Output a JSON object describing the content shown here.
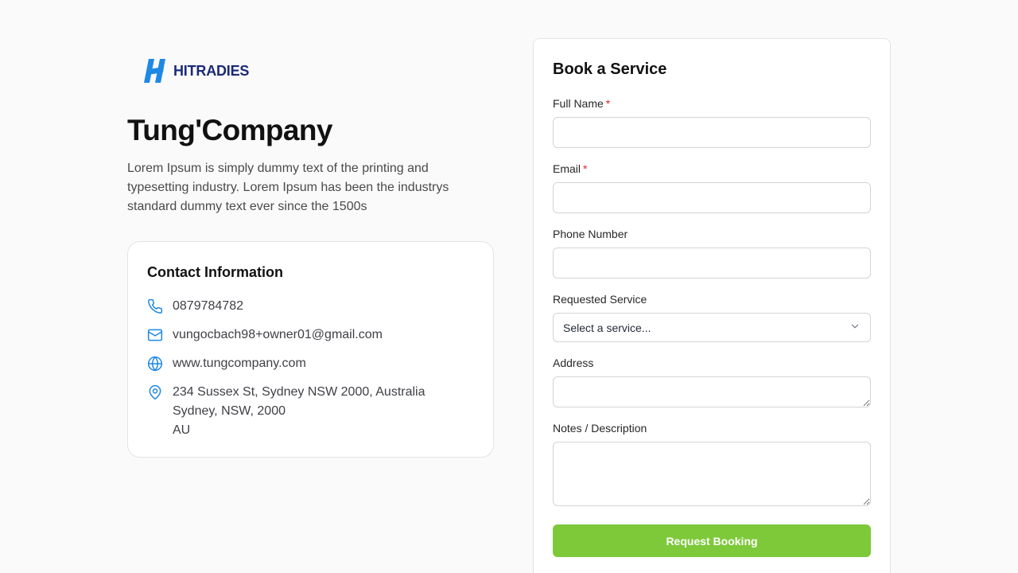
{
  "brand": {
    "logo_text": "HITRADIES",
    "logo_color": "#1b2a78",
    "logo_mark_color": "#1e88e5"
  },
  "company": {
    "name": "Tung'Company",
    "description": "Lorem Ipsum is simply dummy text of the printing and typesetting industry. Lorem Ipsum has been the industrys standard dummy text ever since the 1500s"
  },
  "contact": {
    "title": "Contact Information",
    "icon_color": "#1e88e5",
    "phone": {
      "icon": "phone-icon",
      "value": "0879784782"
    },
    "email": {
      "icon": "mail-icon",
      "value": "vungocbach98+owner01@gmail.com"
    },
    "website": {
      "icon": "globe-icon",
      "value": "www.tungcompany.com"
    },
    "address": {
      "icon": "map-pin-icon",
      "line1": "234 Sussex St, Sydney NSW 2000, Australia",
      "line2": "Sydney, NSW, 2000",
      "line3": "AU"
    }
  },
  "form": {
    "title": "Book a Service",
    "required_marker": "*",
    "full_name": {
      "label": "Full Name",
      "value": ""
    },
    "email": {
      "label": "Email",
      "value": ""
    },
    "phone": {
      "label": "Phone Number",
      "value": ""
    },
    "service": {
      "label": "Requested Service",
      "selected": "Select a service..."
    },
    "address": {
      "label": "Address",
      "value": ""
    },
    "notes": {
      "label": "Notes / Description",
      "value": ""
    },
    "submit_label": "Request Booking",
    "submit_color": "#7dc93a"
  }
}
